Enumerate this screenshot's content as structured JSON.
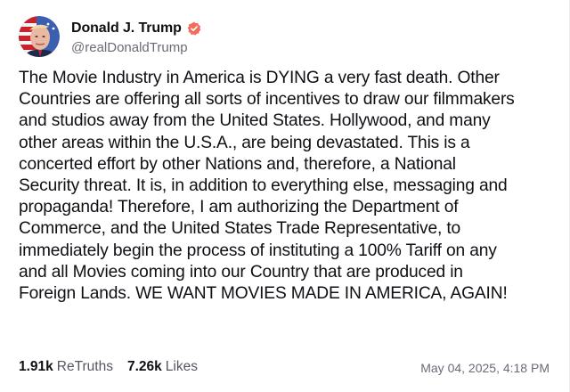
{
  "author": {
    "display_name": "Donald J. Trump",
    "handle": "@realDonaldTrump",
    "avatar_icon": "profile-avatar",
    "verified_icon": "verified-badge-icon",
    "verified_color": "#f26b5b"
  },
  "post": {
    "lines": [
      "The Movie Industry in America is DYING a very fast death. Other",
      "Countries are offering all sorts of incentives to draw our filmmakers",
      "and studios away from the United States. Hollywood, and many",
      "other areas within the U.S.A., are being devastated. This is a",
      "concerted effort by other Nations and, therefore, a National",
      "Security threat. It is, in addition to everything else, messaging and",
      "propaganda! Therefore, I am authorizing the Department of",
      "Commerce, and the United States Trade Representative, to",
      "immediately begin the process of instituting a 100% Tariff on any",
      "and all Movies coming into our Country that are produced in",
      "Foreign Lands. WE WANT MOVIES MADE IN AMERICA, AGAIN!"
    ]
  },
  "stats": {
    "retruths_count": "1.91k",
    "retruths_label": "ReTruths",
    "likes_count": "7.26k",
    "likes_label": "Likes"
  },
  "timestamp": "May 04, 2025, 4:18 PM"
}
